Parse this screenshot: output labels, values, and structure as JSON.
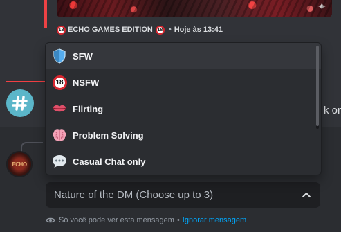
{
  "message": {
    "footer_text": "ECHO GAMES EDITION",
    "footer_separator": "•",
    "timestamp": "Hoje às 13:41",
    "age_badge": "18"
  },
  "partial_text": "k on '",
  "dropdown": {
    "options": [
      {
        "label": "SFW",
        "icon": "shield-icon",
        "selected": true
      },
      {
        "label": "NSFW",
        "icon": "underage-18-icon",
        "icon_text": "18",
        "selected": false
      },
      {
        "label": "Flirting",
        "icon": "lips-icon",
        "selected": false
      },
      {
        "label": "Problem Solving",
        "icon": "brain-icon",
        "selected": false
      },
      {
        "label": "Casual Chat only",
        "icon": "speech-balloon-icon",
        "selected": false
      }
    ]
  },
  "select": {
    "placeholder": "Nature of the DM (Choose up to 3)"
  },
  "ephemeral": {
    "notice": "Só você pode ver esta mensagem",
    "separator": "•",
    "dismiss_label": "Ignorar mensagem"
  },
  "avatar": {
    "logo_text": "ECHO"
  },
  "colors": {
    "background": "#313338",
    "lower_background": "#2b2d31",
    "dropdown_bg": "#2b2d31",
    "selected_row": "#35373c",
    "accent_red": "#f23f43",
    "link_blue": "#00a8fc",
    "hash_teal": "#5bb6c9"
  }
}
